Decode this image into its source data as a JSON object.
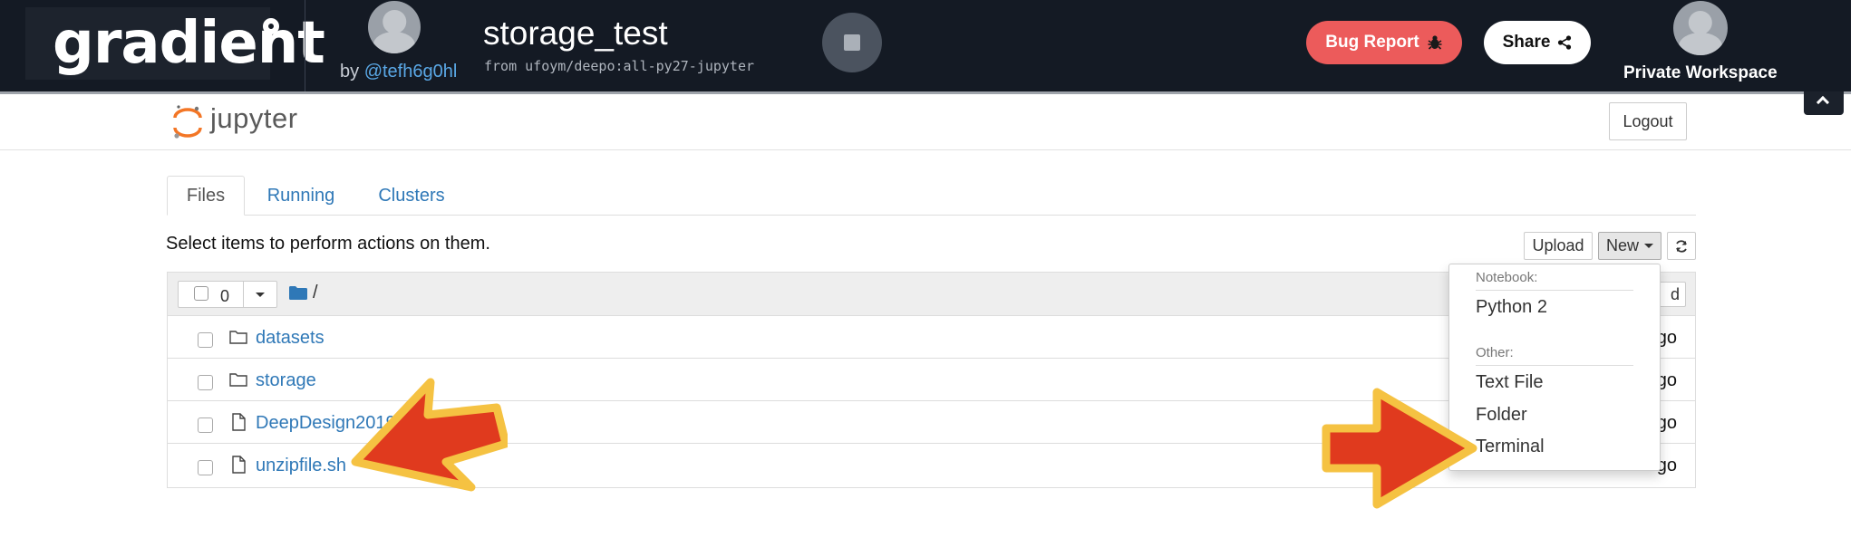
{
  "gradient": {
    "logo_text": "gradient",
    "owner_prefix": "by",
    "owner_handle": "@tefh6g0hl",
    "notebook_title": "storage_test",
    "notebook_source": "from ufoym/deepo:all-py27-jupyter",
    "bug_report_label": "Bug Report",
    "share_label": "Share",
    "workspace_label": "Private Workspace",
    "colors": {
      "topbar": "#141a24",
      "bug_report": "#ec5b5b",
      "link": "#5aa8e6"
    }
  },
  "jupyter": {
    "logo_text": "jupyter",
    "logout_label": "Logout",
    "tabs": [
      {
        "label": "Files",
        "active": true
      },
      {
        "label": "Running",
        "active": false
      },
      {
        "label": "Clusters",
        "active": false
      }
    ],
    "select_hint": "Select items to perform actions on them.",
    "toolbar": {
      "upload_label": "Upload",
      "new_label": "New"
    },
    "list_header": {
      "selected_count": "0",
      "path": "/",
      "right_button_visible_text": "d"
    },
    "files": [
      {
        "name": "datasets",
        "type": "folder",
        "modified_visible": "ago"
      },
      {
        "name": "storage",
        "type": "folder",
        "modified_visible": "ago"
      },
      {
        "name": "DeepDesign2019-",
        "type": "file",
        "modified_visible": "ago"
      },
      {
        "name": "unzipfile.sh",
        "type": "file",
        "modified_visible": "seconds ago"
      }
    ],
    "new_menu": {
      "notebook_heading": "Notebook:",
      "notebook_items": [
        "Python 2"
      ],
      "other_heading": "Other:",
      "other_items": [
        "Text File",
        "Folder",
        "Terminal"
      ]
    },
    "colors": {
      "link": "#2f78b7",
      "logo_orange": "#f37626"
    }
  },
  "annotations": {
    "arrow_color": "#e03a1e",
    "arrow_border": "#f5c242"
  }
}
